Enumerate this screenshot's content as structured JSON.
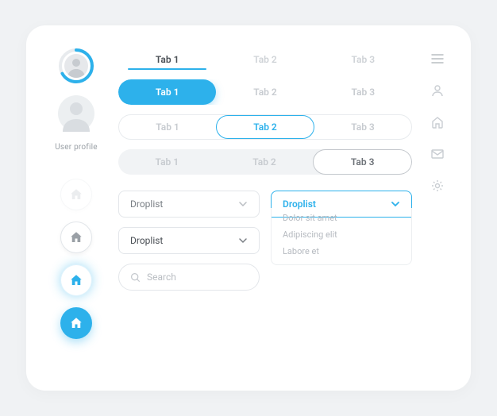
{
  "colors": {
    "accent": "#2db1eb",
    "muted": "#c9cdd2",
    "text": "#4a4f55"
  },
  "sidebar": {
    "profile_label": "User profile"
  },
  "tabs_line": {
    "items": [
      "Tab 1",
      "Tab 2",
      "Tab 3"
    ],
    "active_index": 0
  },
  "pills_row1": {
    "items": [
      "Tab 1",
      "Tab 2",
      "Tab 3"
    ],
    "active_index": 0,
    "style": "fill"
  },
  "pills_row2": {
    "items": [
      "Tab 1",
      "Tab 2",
      "Tab 3"
    ],
    "active_index": 1,
    "style": "outline-blue"
  },
  "pills_row3": {
    "items": [
      "Tab 1",
      "Tab 2",
      "Tab 3"
    ],
    "active_index": 2,
    "style": "outline-grey"
  },
  "droplist": {
    "left1_label": "Droplist",
    "left2_label": "Droplist",
    "right_label": "Droplist",
    "options": [
      "Dolor sit amet",
      "Adipiscing elit",
      "Labore et"
    ]
  },
  "search": {
    "placeholder": "Search"
  },
  "rail": {
    "items": [
      "menu",
      "user",
      "home",
      "mail",
      "settings"
    ]
  }
}
